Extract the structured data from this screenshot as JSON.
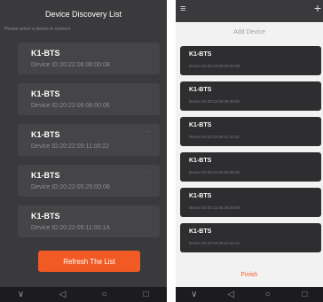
{
  "left": {
    "title": "Device Discovery List",
    "hint": "Please select a device to connect",
    "devices": [
      {
        "name": "K1-BTS",
        "id": "Device ID:20:22:06:08:00:08",
        "badge": ""
      },
      {
        "name": "K1-BTS",
        "id": "Device ID:20:22:06:08:00:06",
        "badge": ""
      },
      {
        "name": "K1-BTS",
        "id": "Device ID:20:22:05:11:00:22",
        "badge": "···"
      },
      {
        "name": "K1-BTS",
        "id": "Device ID:20:22:05:25:00:06",
        "badge": "···"
      },
      {
        "name": "K1-BTS",
        "id": "Device ID:20:22:05:11:00:1A",
        "badge": ""
      }
    ],
    "refresh_label": "Refresh The List"
  },
  "right": {
    "menu_icon": "≡",
    "add_icon": "+",
    "title": "Add Device",
    "devices": [
      {
        "name": "K1-BTS",
        "id": "Device ID:20:22:06:08:00:08"
      },
      {
        "name": "K1-BTS",
        "id": "Device ID:20:22:06:08:00:06"
      },
      {
        "name": "K1-BTS",
        "id": "Device ID:20:22:05:11:00:22"
      },
      {
        "name": "K1-BTS",
        "id": "Device ID:20:22:05:25:00:06"
      },
      {
        "name": "K1-BTS",
        "id": "Device ID:20:22:05:25:00:08"
      },
      {
        "name": "K1-BTS",
        "id": "Device ID:20:22:05:11:00:1A"
      }
    ],
    "finish_label": "Finish"
  },
  "system_nav": {
    "down": "∨",
    "back": "◁",
    "home": "○",
    "recent": "□"
  },
  "colors": {
    "accent": "#f15a24",
    "dark_bg": "#3a3a3c",
    "card_bg": "#454547"
  }
}
